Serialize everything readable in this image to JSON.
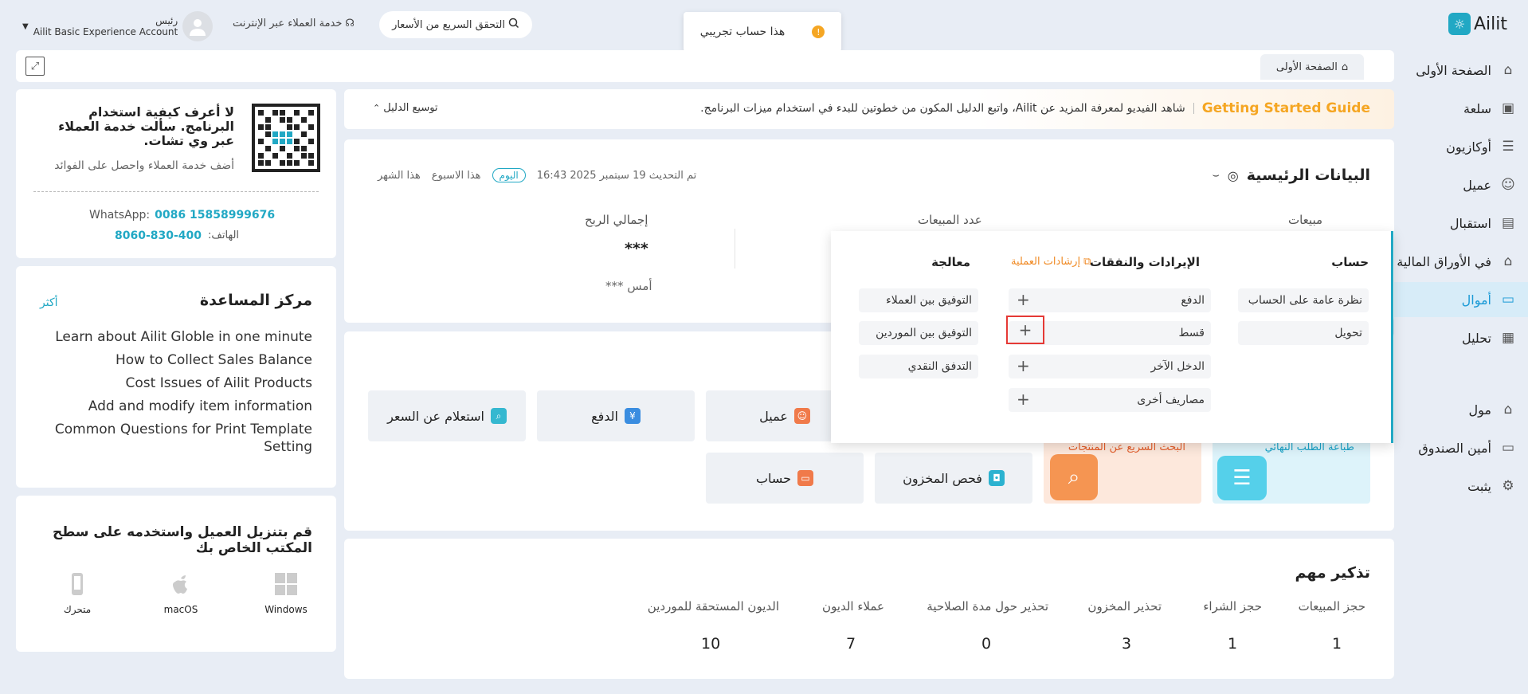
{
  "topbar": {
    "account_name": "رئيس",
    "account_plan": "Ailit Basic Experience Account",
    "online_service": "خدمة العملاء عبر الإنترنت",
    "price_check": "التحقق السريع من الأسعار",
    "trial_notice": "هذا حساب تجريبي",
    "logo_text": "Ailit"
  },
  "sidebar": {
    "items": [
      {
        "label": "الصفحة الأولى",
        "icon": "home-icon"
      },
      {
        "label": "سلعة",
        "icon": "bag-icon"
      },
      {
        "label": "أوكازيون",
        "icon": "clipboard-icon"
      },
      {
        "label": "عميل",
        "icon": "person-icon"
      },
      {
        "label": "استقبال",
        "icon": "receipt-icon"
      },
      {
        "label": "في الأوراق المالية",
        "icon": "warehouse-icon"
      },
      {
        "label": "أموال",
        "icon": "wallet-icon"
      },
      {
        "label": "تحليل",
        "icon": "chart-icon"
      },
      {
        "label": "مول",
        "icon": "store-icon"
      },
      {
        "label": "أمين الصندوق",
        "icon": "monitor-icon"
      },
      {
        "label": "يثبت",
        "icon": "gear-icon"
      }
    ]
  },
  "tabs": {
    "home": "الصفحة الأولى"
  },
  "guide": {
    "title": "Getting Started Guide",
    "text": "شاهد الفيديو لمعرفة المزيد عن Ailit، واتبع الدليل المكون من خطوتين للبدء في استخدام ميزات البرنامج.",
    "expand": "توسيع الدليل"
  },
  "main_data": {
    "title": "البيانات الرئيسية",
    "updated": "تم التحديث 19 سبتمبر 2025 16:43",
    "periods": [
      "اليوم",
      "هذا الاسبوع",
      "هذا الشهر"
    ],
    "metrics": [
      {
        "label": "مبيعات"
      },
      {
        "label": "عدد المبيعات"
      },
      {
        "label": "إجمالي الربح",
        "value": "***",
        "prev": "أمس ***"
      }
    ]
  },
  "dropdown": {
    "col_account": "حساب",
    "col_income": "الإيرادات والنفقات",
    "guide_link": "إرشادات العملية",
    "col_processing": "معالجة",
    "account_items": [
      "نظرة عامة على الحساب",
      "تحويل"
    ],
    "income_items": [
      "الدفع",
      "قسط",
      "الدخل الآخر",
      "مصاريف أخرى"
    ],
    "processing_items": [
      "التوفيق بين العملاء",
      "التوفيق بين الموردين",
      "التدفق النقدي"
    ]
  },
  "quick": {
    "buttons": [
      "عميل",
      "الدفع",
      "استعلام عن السعر",
      "حساب",
      "فحص المخزون"
    ],
    "promo_print": "طباعة الطلب النهائي",
    "promo_search": "البحث السريع عن المنتجات"
  },
  "reminders": {
    "title": "تذكير مهم",
    "items": [
      {
        "label": "حجز المبيعات",
        "value": "1"
      },
      {
        "label": "حجز الشراء",
        "value": "1"
      },
      {
        "label": "تحذير المخزون",
        "value": "3"
      },
      {
        "label": "تحذير حول مدة الصلاحية",
        "value": "0"
      },
      {
        "label": "عملاء الديون",
        "value": "7"
      },
      {
        "label": "الديون المستحقة للموردين",
        "value": "10"
      }
    ]
  },
  "support": {
    "headline": "لا أعرف كيفية استخدام البرنامج. سألت خدمة العملاء عبر وي تشات.",
    "sub": "أضف خدمة العملاء واحصل على الفوائد",
    "whatsapp_label": "WhatsApp:",
    "whatsapp": "0086 15858999676",
    "phone_label": "الهاتف:",
    "phone": "8060-830-400"
  },
  "help": {
    "title": "مركز المساعدة",
    "more": "أكثر",
    "links": [
      "Learn about Ailit Globle in one minute",
      "How to Collect Sales Balance",
      "Cost Issues of Ailit Products",
      "Add and modify item information",
      "Common Questions for Print Template Setting"
    ]
  },
  "download": {
    "title": "قم بتنزيل العميل واستخدمه على سطح المكتب الخاص بك",
    "platforms": [
      {
        "label": "Windows",
        "icon": "windows-icon"
      },
      {
        "label": "macOS",
        "icon": "apple-icon"
      },
      {
        "label": "متحرك",
        "icon": "mobile-icon"
      }
    ]
  },
  "colors": {
    "accent": "#1a9ad6",
    "orange": "#f5a623",
    "teal": "#21a8c4",
    "highlight_box": "#e53935"
  }
}
